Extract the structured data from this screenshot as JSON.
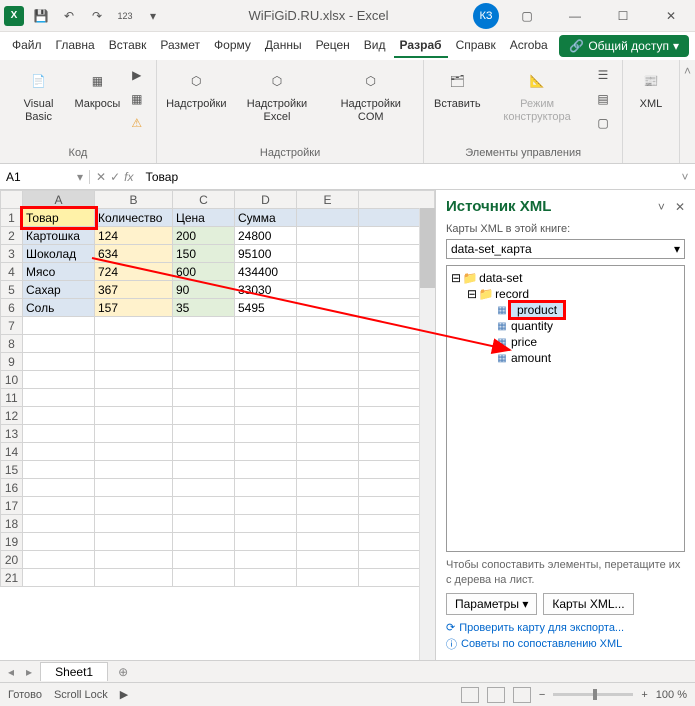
{
  "titlebar": {
    "app": "X",
    "filename": "WiFiGiD.RU.xlsx - Excel",
    "user": "КЗ"
  },
  "menus": [
    "Файл",
    "Главна",
    "Вставк",
    "Размет",
    "Форму",
    "Данны",
    "Рецен",
    "Вид",
    "Разраб",
    "Справк",
    "Acroba"
  ],
  "active_menu": "Разраб",
  "share_label": "Общий доступ",
  "ribbon": {
    "groups": [
      {
        "label": "Код",
        "items": [
          "Visual Basic",
          "Макросы"
        ]
      },
      {
        "label": "Надстройки",
        "items": [
          "Надстройки",
          "Надстройки Excel",
          "Надстройки COM"
        ]
      },
      {
        "label": "Элементы управления",
        "items": [
          "Вставить",
          "Режим конструктора"
        ]
      },
      {
        "label": "",
        "items": [
          "XML"
        ]
      }
    ]
  },
  "namebox": "A1",
  "formula": "Товар",
  "headers": [
    "Товар",
    "Количество",
    "Цена",
    "Сумма"
  ],
  "rows": [
    {
      "a": "Картошка",
      "b": "124",
      "c": "200",
      "d": "24800"
    },
    {
      "a": "Шоколад",
      "b": "634",
      "c": "150",
      "d": "95100"
    },
    {
      "a": "Мясо",
      "b": "724",
      "c": "600",
      "d": "434400"
    },
    {
      "a": "Сахар",
      "b": "367",
      "c": "90",
      "d": "33030"
    },
    {
      "a": "Соль",
      "b": "157",
      "c": "35",
      "d": "5495"
    }
  ],
  "cols": [
    "A",
    "B",
    "C",
    "D",
    "E"
  ],
  "sheet": "Sheet1",
  "xml": {
    "title": "Источник XML",
    "maps_label": "Карты XML в этой книге:",
    "map_selected": "data-set_карта",
    "tree": {
      "root": "data-set",
      "record": "record",
      "fields": [
        "product",
        "quantity",
        "price",
        "amount"
      ]
    },
    "hint": "Чтобы сопоставить элементы, перетащите их с дерева на лист.",
    "params_btn": "Параметры",
    "maps_btn": "Карты XML...",
    "verify_link": "Проверить карту для экспорта...",
    "tips_link": "Советы по сопоставлению XML"
  },
  "status": {
    "ready": "Готово",
    "scroll": "Scroll Lock",
    "zoom": "100 %"
  }
}
